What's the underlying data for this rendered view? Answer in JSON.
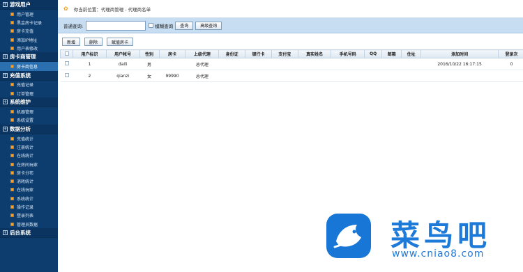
{
  "sidebar": {
    "sections": [
      {
        "title": "游戏用户",
        "items": [
          "用户管理",
          "黑金房卡记录",
          "房卡充值",
          "添加IP地址",
          "用户表修改"
        ]
      },
      {
        "title": "房卡商管理",
        "items": [
          "房卡商信息"
        ]
      },
      {
        "title": "充值系统",
        "items": [
          "充值记录",
          "订单管理"
        ]
      },
      {
        "title": "系统维护",
        "items": [
          "机器管理",
          "系统设置"
        ]
      },
      {
        "title": "数据分析",
        "items": [
          "充值统计",
          "注册统计",
          "在线统计",
          "在房间玩家",
          "房卡分布",
          "消耗统计",
          "在线玩家",
          "系统统计",
          "操作记录",
          "登录列表",
          "管理员数据"
        ]
      },
      {
        "title": "后台系统",
        "items": []
      }
    ],
    "active_item": "房卡商信息"
  },
  "breadcrumb": {
    "text": "你当前位置：代理商管理 - 代理商名单"
  },
  "search": {
    "label": "普通查询:",
    "value": "",
    "placeholder": "",
    "exact_label": "模糊查询",
    "query_button": "查询",
    "advanced_button": "高级查询"
  },
  "toolbar": {
    "add_button": "新增",
    "delete_button": "删除",
    "assign_button": "赋值房卡"
  },
  "table": {
    "columns": [
      "",
      "用户标识",
      "用户帐号",
      "性别",
      "房卡",
      "上级代理",
      "身份证",
      "银行卡",
      "支付宝",
      "真实姓名",
      "手机号码",
      "QQ",
      "邮箱",
      "住址",
      "添加时间",
      "登录次"
    ],
    "rows": [
      [
        "",
        "1",
        "daili",
        "男",
        "",
        "总代理",
        "",
        "",
        "",
        "",
        "",
        "",
        "",
        "",
        "2016/10/22 16:17:15",
        "0"
      ],
      [
        "",
        "2",
        "qianzi",
        "女",
        "99990",
        "总代理",
        "",
        "",
        "",
        "",
        "",
        "",
        "",
        "",
        "",
        ""
      ]
    ]
  },
  "logo": {
    "brand": "菜鸟吧",
    "url": "www.cniao8.com"
  },
  "colors": {
    "sidebar_bg": "#0d3d6e",
    "active_item": "#2a6fb0",
    "searchbar_bg": "#c7ddf1",
    "logo_blue": "#1e7ad9",
    "menu_dot": "#f0a23a"
  }
}
